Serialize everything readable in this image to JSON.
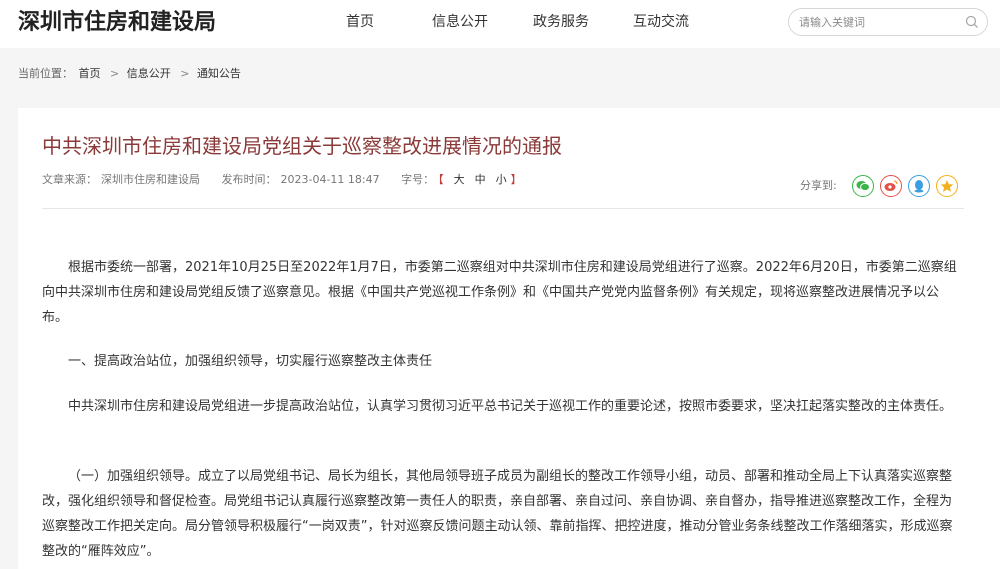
{
  "header": {
    "logo": "深圳市住房和建设局",
    "nav": [
      "首页",
      "信息公开",
      "政务服务",
      "互动交流"
    ],
    "search": {
      "placeholder": "请输入关键词"
    }
  },
  "breadcrumb": {
    "label": "当前位置：",
    "items": [
      "首页",
      "信息公开",
      "通知公告"
    ],
    "separator": ">"
  },
  "article": {
    "title": "中共深圳市住房和建设局党组关于巡察整改进展情况的通报",
    "meta": {
      "source_label": "文章来源：",
      "source": "深圳市住房和建设局",
      "time_label": "发布时间：",
      "time": "2023-04-11 18:47",
      "fontsize_label": "字号：",
      "bracket_open": "【",
      "bracket_close": "】",
      "fontsize_options": [
        "大",
        "中",
        "小"
      ]
    },
    "share": {
      "label": "分享到:",
      "channels": [
        {
          "name": "wechat",
          "color": "#3bb54a"
        },
        {
          "name": "weibo",
          "color": "#e4504a"
        },
        {
          "name": "qq",
          "color": "#3a9fe0"
        },
        {
          "name": "qzone",
          "color": "#f2b01c"
        }
      ]
    },
    "paragraphs": [
      "根据市委统一部署，2021年10月25日至2022年1月7日，市委第二巡察组对中共深圳市住房和建设局党组进行了巡察。2022年6月20日，市委第二巡察组向中共深圳市住房和建设局党组反馈了巡察意见。根据《中国共产党巡视工作条例》和《中国共产党党内监督条例》有关规定，现将巡察整改进展情况予以公布。",
      "一、提高政治站位，加强组织领导，切实履行巡察整改主体责任",
      "中共深圳市住房和建设局党组进一步提高政治站位，认真学习贯彻习近平总书记关于巡视工作的重要论述，按照市委要求，坚决扛起落实整改的主体责任。",
      "（一）加强组织领导。成立了以局党组书记、局长为组长，其他局领导班子成员为副组长的整改工作领导小组，动员、部署和推动全局上下认真落实巡察整改，强化组织领导和督促检查。局党组书记认真履行巡察整改第一责任人的职责，亲自部署、亲自过问、亲自协调、亲自督办，指导推进巡察整改工作，全程为巡察整改工作把关定向。局分管领导积极履行“一岗双责”，针对巡察反馈问题主动认领、靠前指挥、把控进度，推动分管业务条线整改工作落细落实，形成巡察整改的“雁阵效应”。"
    ]
  }
}
